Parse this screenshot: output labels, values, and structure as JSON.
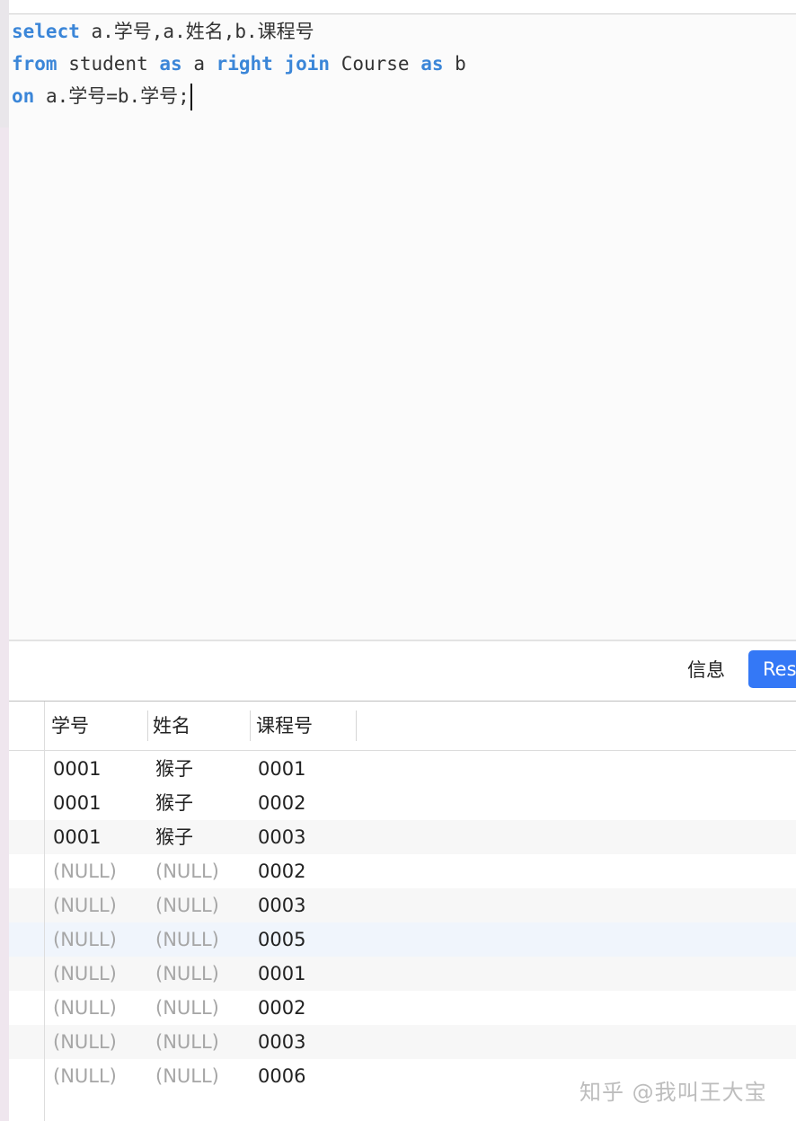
{
  "editor": {
    "lines": [
      [
        {
          "t": "select",
          "k": true
        },
        {
          "t": " a.学号,a.姓名,b.课程号",
          "k": false
        }
      ],
      [
        {
          "t": "from",
          "k": true
        },
        {
          "t": " student ",
          "k": false
        },
        {
          "t": "as",
          "k": true
        },
        {
          "t": " a ",
          "k": false
        },
        {
          "t": "right",
          "k": true
        },
        {
          "t": " ",
          "k": false
        },
        {
          "t": "join",
          "k": true
        },
        {
          "t": " Course ",
          "k": false
        },
        {
          "t": "as",
          "k": true
        },
        {
          "t": " b",
          "k": false
        }
      ],
      [
        {
          "t": "on",
          "k": true
        },
        {
          "t": " a.学号=b.学号;",
          "k": false
        }
      ]
    ]
  },
  "tabs": {
    "info_label": "信息",
    "result_label": "Res"
  },
  "table": {
    "columns": [
      "学号",
      "姓名",
      "课程号"
    ],
    "rows": [
      [
        "0001",
        "猴子",
        "0001"
      ],
      [
        "0001",
        "猴子",
        "0002"
      ],
      [
        "0001",
        "猴子",
        "0003"
      ],
      [
        "(NULL)",
        "(NULL)",
        "0002"
      ],
      [
        "(NULL)",
        "(NULL)",
        "0003"
      ],
      [
        "(NULL)",
        "(NULL)",
        "0005"
      ],
      [
        "(NULL)",
        "(NULL)",
        "0001"
      ],
      [
        "(NULL)",
        "(NULL)",
        "0002"
      ],
      [
        "(NULL)",
        "(NULL)",
        "0003"
      ],
      [
        "(NULL)",
        "(NULL)",
        "0006"
      ]
    ]
  },
  "watermark": "知乎 @我叫王大宝",
  "colors": {
    "keyword": "#3b86d8",
    "accent": "#3478f6",
    "null_text": "#a6a6a6"
  }
}
